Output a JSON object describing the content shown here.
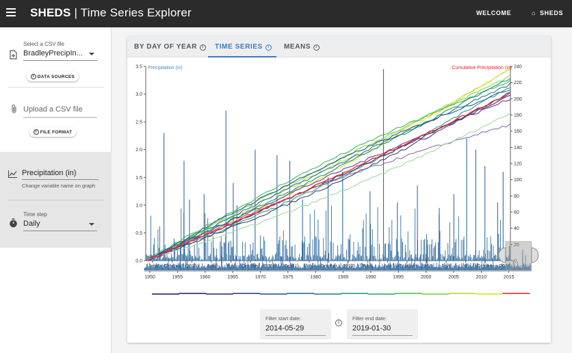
{
  "appbar": {
    "brand": "SHEDS",
    "separator": "|",
    "title": "Time Series Explorer",
    "nav_welcome": "WELCOME",
    "nav_sheds": "SHEDS"
  },
  "sidebar": {
    "csv_label": "Select a CSV file",
    "csv_value": "BradleyPrecipIn...",
    "data_sources_button": "DATA SOURCES",
    "upload_placeholder": "Upload a CSV file",
    "file_format_button": "FILE FORMAT",
    "variable_name": "Precipitation (in)",
    "variable_hint": "Change variable name on graph",
    "timestep_label": "Time step",
    "timestep_value": "Daily"
  },
  "tabs": [
    {
      "label": "BY DAY OF YEAR"
    },
    {
      "label": "TIME SERIES"
    },
    {
      "label": "MEANS"
    }
  ],
  "filters": {
    "start_label": "Filter start date:",
    "start_value": "2014-05-29",
    "end_label": "Filter end date:",
    "end_value": "2019-01-30"
  },
  "colors": {
    "accent": "#3d7bb5",
    "bars": "#2f6aa0",
    "cumulative_label": "#d9262c",
    "appbar": "#2b2b2b"
  },
  "chart_data": [
    {
      "type": "bar",
      "name": "main",
      "legend_left": "Precipitation (in)",
      "legend_right": "Cumulative Precipitation (in)",
      "y_left_ticks": [
        "0.0",
        "0.5",
        "1.0",
        "1.5",
        "2.0",
        "2.5",
        "3.0",
        "3.5"
      ],
      "y_left_range": [
        0,
        3.5
      ],
      "y_right_ticks": [
        "0",
        "20",
        "40",
        "60",
        "80",
        "100",
        "120",
        "140",
        "160",
        "180",
        "200",
        "220",
        "240"
      ],
      "y_right_range": [
        0,
        240
      ],
      "x_ticks": [
        "July",
        "October",
        "2015",
        "April",
        "July",
        "October",
        "2016",
        "April",
        "July",
        "October",
        "2017",
        "April",
        "July",
        "October",
        "2018",
        "April",
        "July",
        "October",
        "2019"
      ],
      "bar_peaks": [
        {
          "x": 0.05,
          "y": 2.3
        },
        {
          "x": 0.105,
          "y": 1.8
        },
        {
          "x": 0.12,
          "y": 1.1
        },
        {
          "x": 0.16,
          "y": 1.2
        },
        {
          "x": 0.22,
          "y": 2.7
        },
        {
          "x": 0.24,
          "y": 1.4
        },
        {
          "x": 0.25,
          "y": 1.0
        },
        {
          "x": 0.3,
          "y": 2.0
        },
        {
          "x": 0.36,
          "y": 1.9
        },
        {
          "x": 0.395,
          "y": 1.8
        },
        {
          "x": 0.43,
          "y": 1.1
        },
        {
          "x": 0.5,
          "y": 1.5
        },
        {
          "x": 0.54,
          "y": 1.6
        },
        {
          "x": 0.615,
          "y": 1.25
        },
        {
          "x": 0.652,
          "y": 3.45
        },
        {
          "x": 0.69,
          "y": 1.05
        },
        {
          "x": 0.745,
          "y": 1.35
        },
        {
          "x": 0.805,
          "y": 0.95
        },
        {
          "x": 0.845,
          "y": 1.2
        },
        {
          "x": 0.88,
          "y": 2.2
        },
        {
          "x": 0.905,
          "y": 2.0
        },
        {
          "x": 0.93,
          "y": 1.7
        },
        {
          "x": 0.965,
          "y": 1.05
        },
        {
          "x": 0.98,
          "y": 1.6
        }
      ],
      "cumulative_series": [
        {
          "color": "#e6e61a",
          "end": 238
        },
        {
          "color": "#b9e34a",
          "end": 236
        },
        {
          "color": "#80d44a",
          "end": 228
        },
        {
          "color": "#3bb85a",
          "end": 222
        },
        {
          "color": "#27a07a",
          "end": 215
        },
        {
          "color": "#1f8a84",
          "end": 226
        },
        {
          "color": "#24728c",
          "end": 218
        },
        {
          "color": "#2a5c8e",
          "end": 212
        },
        {
          "color": "#343f86",
          "end": 208
        },
        {
          "color": "#3a2a76",
          "end": 205
        },
        {
          "color": "#5e3f92",
          "end": 200
        },
        {
          "color": "#8a6cb0",
          "end": 168
        },
        {
          "color": "#9fd7a0",
          "end": 182
        },
        {
          "color": "#e8262c",
          "end": 207
        }
      ]
    },
    {
      "type": "bar",
      "name": "overview",
      "x_ticks": [
        "1950",
        "1955",
        "1960",
        "1965",
        "1970",
        "1975",
        "1980",
        "1985",
        "1990",
        "1995",
        "2000",
        "2005",
        "2010",
        "2015"
      ],
      "x_range": [
        1949,
        2019
      ],
      "brush_years": [
        2014.4,
        2019.1
      ]
    }
  ]
}
